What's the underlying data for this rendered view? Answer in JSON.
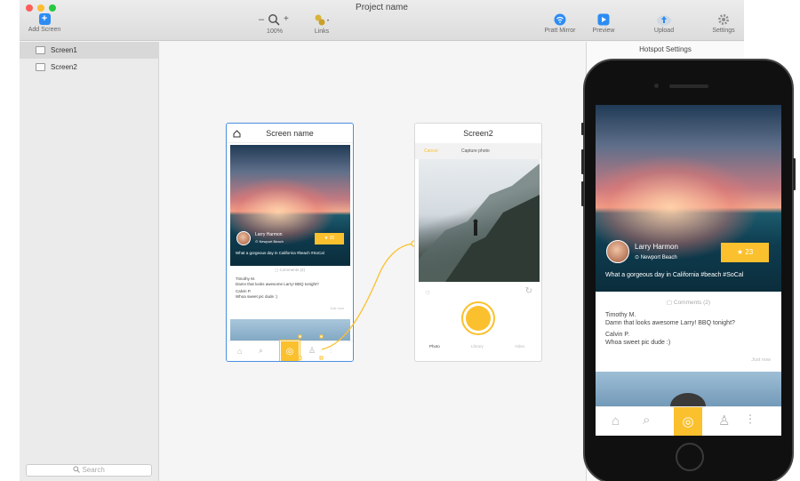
{
  "window": {
    "title": "Project name"
  },
  "toolbar": {
    "add_screen": "Add Screen",
    "zoom_minus": "–",
    "zoom_plus": "+",
    "zoom": "100%",
    "links": "Links",
    "mirror": "Pratt Mirror",
    "preview": "Preview",
    "upload": "Upload",
    "settings": "Settings"
  },
  "sidebar": {
    "items": [
      {
        "label": "Screen1"
      },
      {
        "label": "Screen2"
      }
    ],
    "search_placeholder": "Search"
  },
  "panel": {
    "title": "Hotspot Settings"
  },
  "screen1": {
    "title": "Screen name",
    "user_name": "Larry Harmon",
    "location": "Newport Beach",
    "likes": "15",
    "caption": "What a gorgeous day in California #beach #SoCal",
    "comments_label": "Comments (2)",
    "c1_name": "Timothy M.",
    "c1_text": "Damn that looks awesome Larry! BBQ tonight?",
    "c2_name": "Calvin P.",
    "c2_text": "Whoa sweet pic dude :)",
    "time": "Just now"
  },
  "screen2": {
    "title": "Screen2",
    "cancel": "Cancel",
    "capture": "Capture photo",
    "tabs": [
      "Photo",
      "Library",
      "Video"
    ]
  },
  "phone": {
    "user_name": "Larry Harmon",
    "location": "Newport Beach",
    "likes": "23",
    "caption": "What a gorgeous day in California #beach #SoCal",
    "comments_label": "Comments (2)",
    "c1_name": "Timothy M.",
    "c1_text": "Damn that looks awesome Larry! BBQ tonight?",
    "c2_name": "Calvin P.",
    "c2_text": "Whoa sweet pic dude :)",
    "time": "Just now"
  },
  "colors": {
    "accent": "#fbc02d",
    "selection": "#4a90e2",
    "toolbar_blue": "#2c8cf4"
  },
  "icons": [
    "plus-icon",
    "zoom-icon",
    "links-icon",
    "wifi-icon",
    "play-icon",
    "upload-icon",
    "gear-icon",
    "home-icon",
    "search-icon",
    "camera-icon",
    "user-icon",
    "sliders-icon",
    "star-icon",
    "pin-icon",
    "comment-icon",
    "sun-icon",
    "refresh-icon"
  ]
}
